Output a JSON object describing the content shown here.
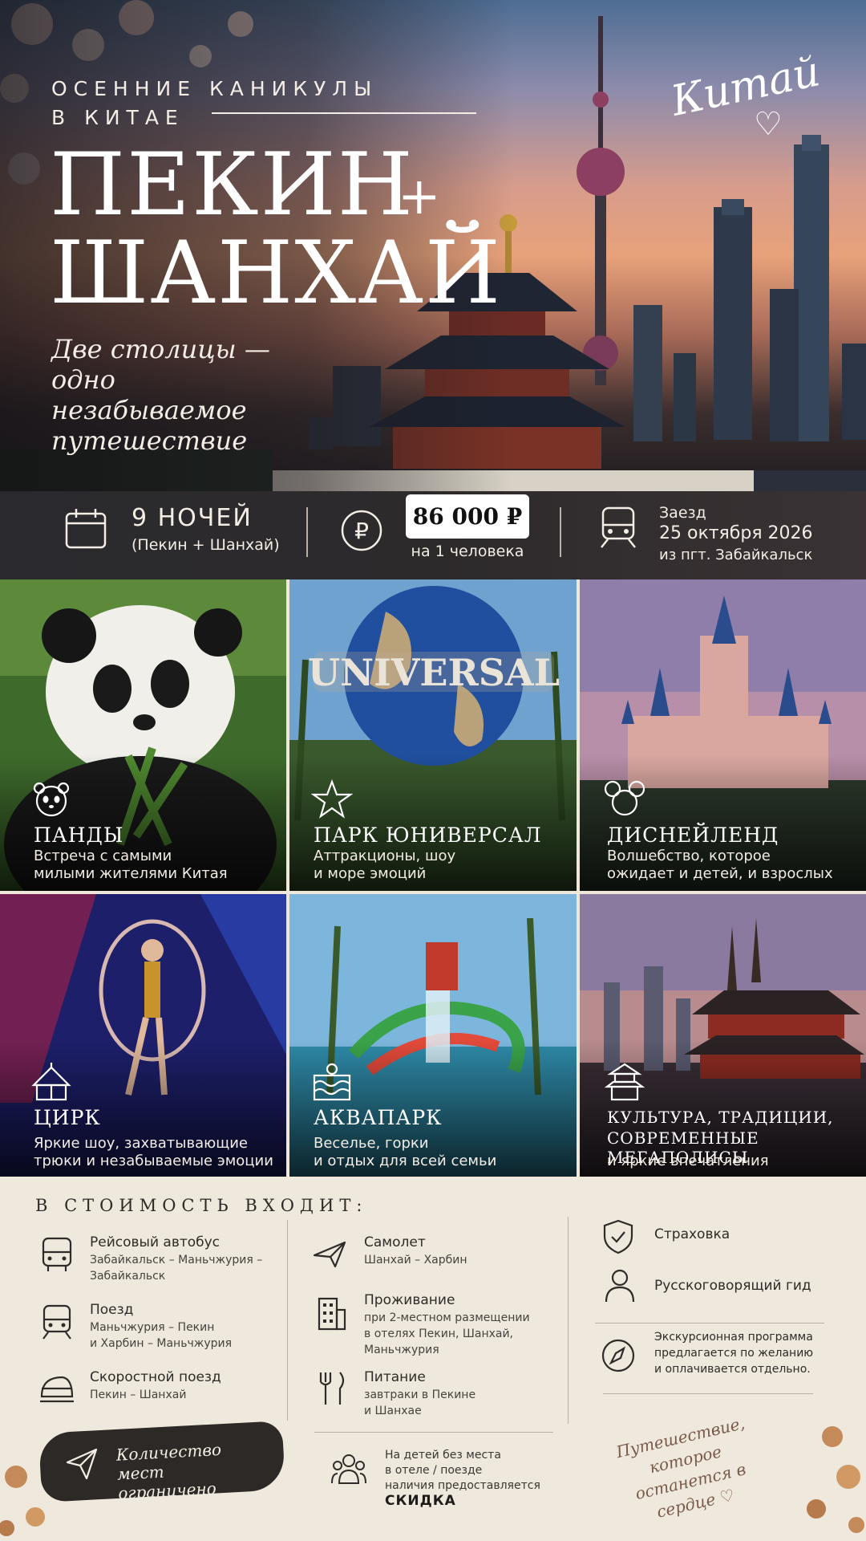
{
  "hero": {
    "kicker_line1": "ОСЕННИЕ КАНИКУЛЫ",
    "kicker_line2": "В КИТАЕ",
    "title_line1": "ПЕКИН",
    "title_plus": "+",
    "title_line2": "ШАНХАЙ",
    "subtitle": "Две столицы — одно незабываемое путешествие",
    "script_tag": "Китай"
  },
  "info": {
    "nights": "9 НОЧЕЙ",
    "nights_sub": "(Пекин + Шанхай)",
    "price": "86 000 ₽",
    "price_sub": "на 1 человека",
    "arrival_label": "Заезд",
    "arrival_date": "25 октября 2026",
    "arrival_from": "из пгт. Забайкальск"
  },
  "cards": [
    {
      "title": "ПАНДЫ",
      "desc1": "Встреча с самыми",
      "desc2": "милыми жителями Китая",
      "icon": "panda-icon"
    },
    {
      "title": "ПАРК ЮНИВЕРСАЛ",
      "desc1": "Аттракционы, шоу",
      "desc2": "и море эмоций",
      "icon": "star-icon",
      "globe_text": "UNIVERSAL"
    },
    {
      "title": "ДИСНЕЙЛЕНД",
      "desc1": "Волшебство, которое",
      "desc2": "ожидает и детей, и взрослых",
      "icon": "mickey-icon"
    },
    {
      "title": "ЦИРК",
      "desc1": "Яркие шоу, захватывающие",
      "desc2": "трюки и незабываемые эмоции",
      "icon": "circus-tent-icon"
    },
    {
      "title": "АКВАПАРК",
      "desc1": "Веселье, горки",
      "desc2": "и отдых для всей семьи",
      "icon": "water-icon"
    },
    {
      "title": "КУЛЬТУРА, ТРАДИЦИИ,",
      "title2": "СОВРЕМЕННЫЕ МЕГАПОЛИСЫ",
      "desc1": "и яркие впечатления",
      "icon": "pagoda-icon"
    }
  ],
  "included": {
    "heading": "В СТОИМОСТЬ ВХОДИТ:",
    "bus": {
      "title": "Рейсовый автобус",
      "l1": "Забайкальск – Маньчжурия –",
      "l2": "Забайкальск"
    },
    "train": {
      "title": "Поезд",
      "l1": "Маньчжурия – Пекин",
      "l2": "и Харбин – Маньчжурия"
    },
    "fast_train": {
      "title": "Скоростной поезд",
      "l1": "Пекин – Шанхай"
    },
    "plane": {
      "title": "Самолет",
      "l1": "Шанхай – Харбин"
    },
    "hotel": {
      "title": "Проживание",
      "l1": "при 2-местном размещении",
      "l2": "в отелях Пекин, Шанхай,",
      "l3": "Маньчжурия"
    },
    "food": {
      "title": "Питание",
      "l1": "завтраки в Пекине",
      "l2": "и Шанхае"
    },
    "insurance": {
      "title": "Страховка"
    },
    "guide": {
      "title": "Русскоговорящий гид"
    },
    "excursion": {
      "l1": "Экскурсионная программа",
      "l2": "предлагается по желанию",
      "l3": "и оплачивается отдельно."
    },
    "limited": "Количество мест ограничено",
    "kids_l1": "На детей без места",
    "kids_l2": "в отеле / поезде",
    "kids_l3": "наличия предоставляется",
    "kids_bold": "СКИДКА",
    "signature": "Путешествие, которое останется в сердце ♡"
  }
}
